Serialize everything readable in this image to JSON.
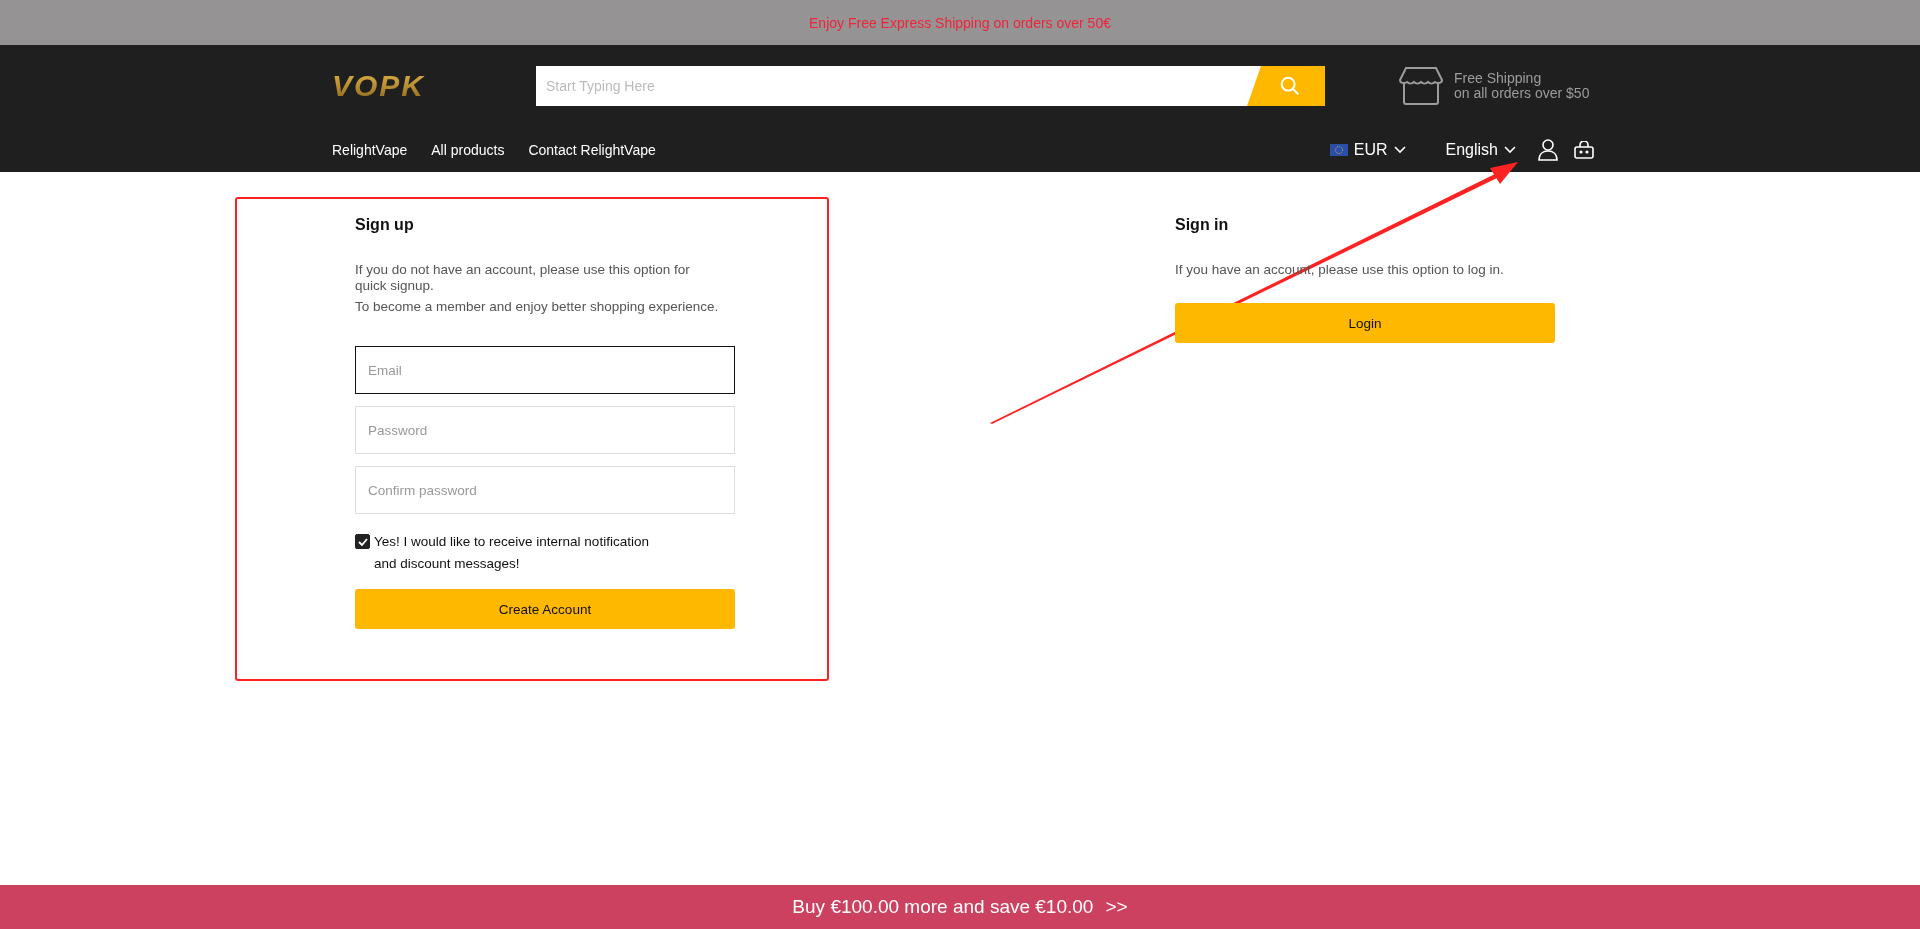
{
  "announcement": "Enjoy Free Express Shipping on orders over 50€",
  "header": {
    "logo": "VOPK",
    "search": {
      "placeholder": "Start Typing Here"
    },
    "shipping": {
      "title": "Free Shipping",
      "subtitle": "on all orders over $50"
    },
    "nav": [
      "RelightVape",
      "All products",
      "Contact RelightVape"
    ],
    "currency": "EUR",
    "language": "English"
  },
  "signup": {
    "title": "Sign up",
    "paragraphs": [
      "If you do not have an account, please use this option for quick signup.",
      "To become a member and enjoy better shopping experience."
    ],
    "fields": [
      {
        "placeholder": "Email",
        "focused": true
      },
      {
        "placeholder": "Password",
        "focused": false
      },
      {
        "placeholder": "Confirm password",
        "focused": false
      }
    ],
    "newsletter": {
      "checked": true,
      "label": "Yes! I would like to receive internal notification and discount messages!"
    },
    "button": "Create Account"
  },
  "signin": {
    "title": "Sign in",
    "text": "If you have an account, please use this option to log in.",
    "button": "Login"
  },
  "promo": {
    "text": "Buy €100.00 more and save €10.00",
    "arrow": ">>"
  }
}
